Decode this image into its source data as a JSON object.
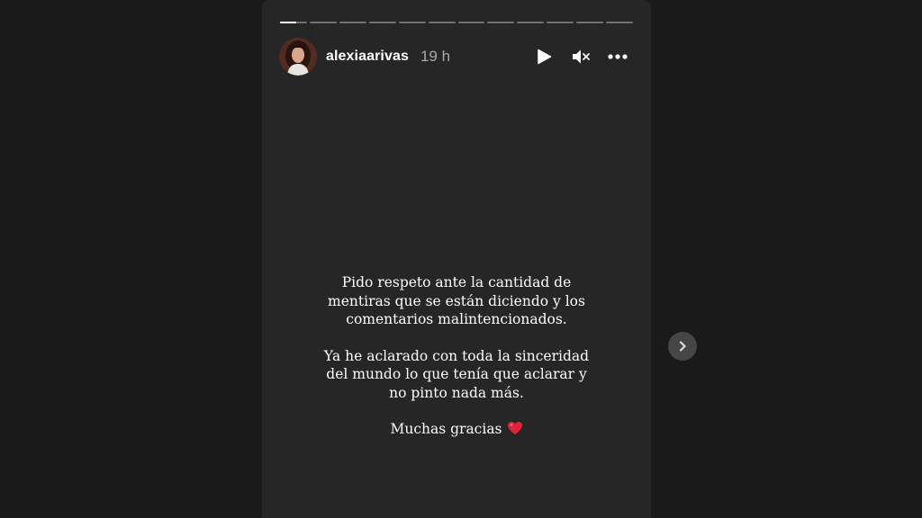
{
  "story": {
    "username": "alexiaarivas",
    "time_ago": "19 h",
    "segments": [
      {
        "progress": 0.6
      },
      {
        "progress": 0
      },
      {
        "progress": 0
      },
      {
        "progress": 0
      },
      {
        "progress": 0
      },
      {
        "progress": 0
      },
      {
        "progress": 0
      },
      {
        "progress": 0
      },
      {
        "progress": 0
      },
      {
        "progress": 0
      },
      {
        "progress": 0
      },
      {
        "progress": 0
      }
    ],
    "controls": {
      "play_icon": "play-icon",
      "mute_icon": "muted-speaker-icon",
      "more_icon": "more-options-icon"
    },
    "message": {
      "paragraph_1_line_1": "Pido respeto ante la cantidad de",
      "paragraph_1_line_2": "mentiras que se están diciendo y los",
      "paragraph_1_line_3": "comentarios malintencionados.",
      "paragraph_2_line_1": "Ya he aclarado con toda la sinceridad",
      "paragraph_2_line_2": "del mundo lo que tenía que aclarar y",
      "paragraph_2_line_3": "no pinto nada más.",
      "paragraph_3": "Muchas gracias",
      "emoji": "red-heart-icon"
    }
  },
  "navigation": {
    "next_icon": "chevron-right-icon"
  },
  "colors": {
    "page_background": "#1a1a1a",
    "story_background": "#262626",
    "heart": "#e0223a"
  }
}
